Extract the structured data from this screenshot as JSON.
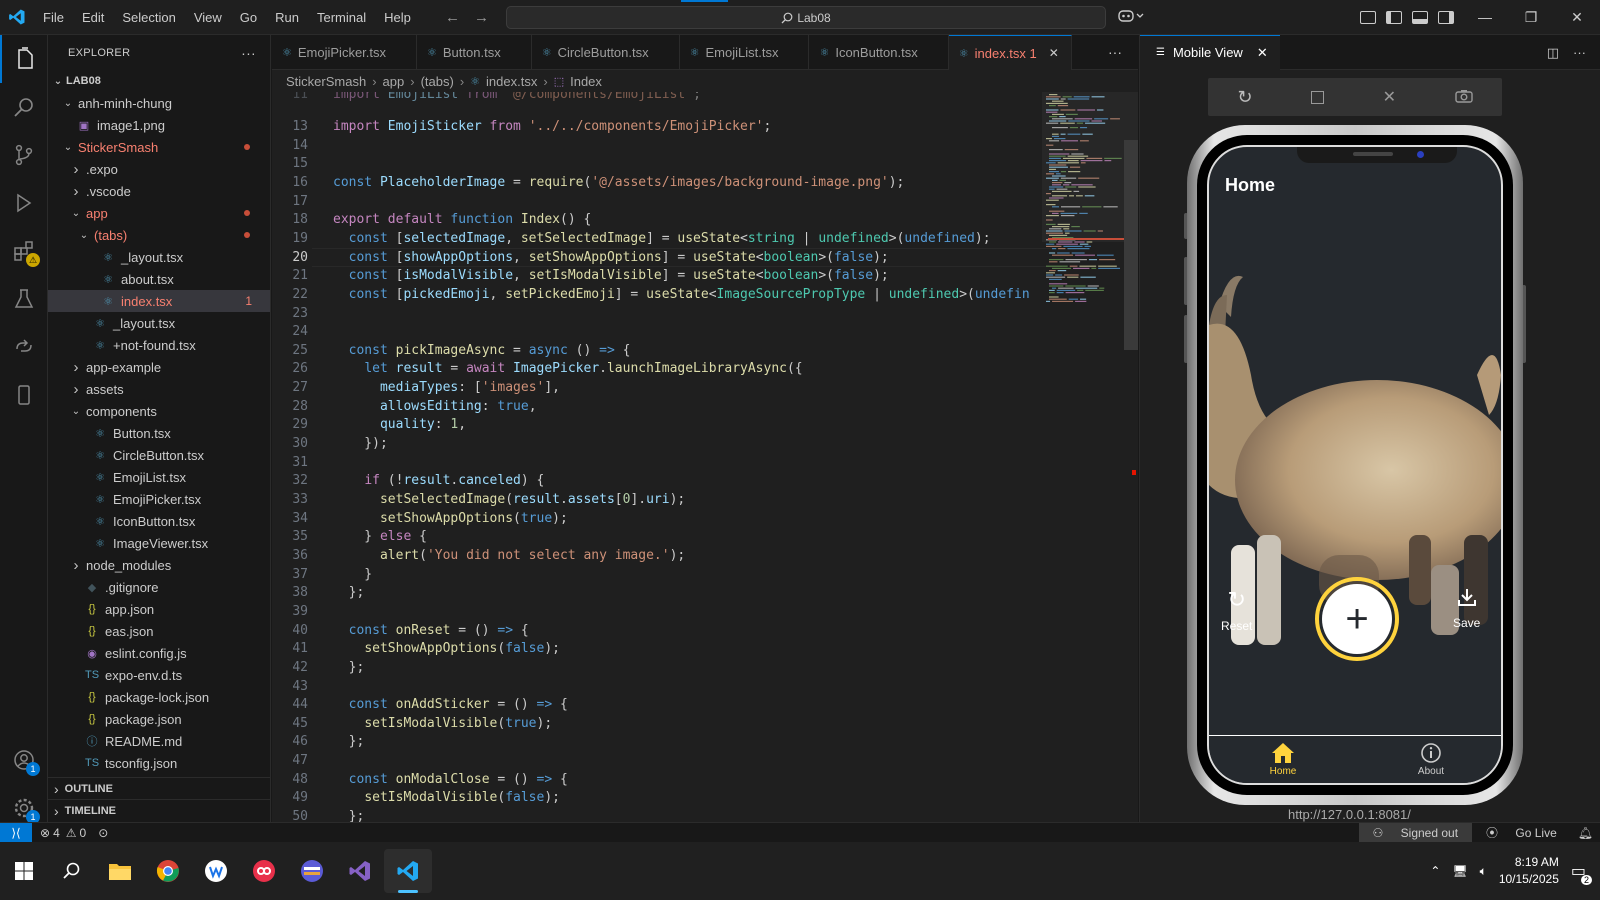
{
  "window": {
    "menu": [
      "File",
      "Edit",
      "Selection",
      "View",
      "Go",
      "Run",
      "Terminal",
      "Help"
    ],
    "search_text": "Lab08"
  },
  "activity_bar": [
    {
      "icon": "files-icon"
    },
    {
      "icon": "search-icon"
    },
    {
      "icon": "source-control-icon"
    },
    {
      "icon": "run-debug-icon"
    },
    {
      "icon": "extensions-icon",
      "badge": "⚠"
    },
    {
      "icon": "testing-icon"
    },
    {
      "icon": "remote-explorer-icon"
    },
    {
      "icon": "device-icon"
    }
  ],
  "activity_bottom": [
    {
      "icon": "account-icon",
      "badge": "1"
    },
    {
      "icon": "settings-gear-icon",
      "badge": "1"
    }
  ],
  "sidebar": {
    "title": "EXPLORER",
    "more": "···",
    "root": "LAB08",
    "items": [
      {
        "label": "anh-minh-chung",
        "depth": 1,
        "type": "folder",
        "open": true
      },
      {
        "label": "image1.png",
        "depth": 1,
        "type": "png"
      },
      {
        "label": "StickerSmash",
        "depth": 1,
        "type": "folder",
        "open": true,
        "modified": true
      },
      {
        "label": ".expo",
        "depth": 2,
        "type": "folder",
        "open": false
      },
      {
        "label": ".vscode",
        "depth": 2,
        "type": "folder",
        "open": false
      },
      {
        "label": "app",
        "depth": 2,
        "type": "folder",
        "open": true,
        "modified": true
      },
      {
        "label": "(tabs)",
        "depth": 3,
        "type": "folder",
        "open": true,
        "modified": true
      },
      {
        "label": "_layout.tsx",
        "depth": 4,
        "type": "tsx"
      },
      {
        "label": "about.tsx",
        "depth": 4,
        "type": "tsx"
      },
      {
        "label": "index.tsx",
        "depth": 4,
        "type": "tsx",
        "selected": true,
        "errors": "1"
      },
      {
        "label": "_layout.tsx",
        "depth": 3,
        "type": "tsx"
      },
      {
        "label": "+not-found.tsx",
        "depth": 3,
        "type": "tsx"
      },
      {
        "label": "app-example",
        "depth": 2,
        "type": "folder",
        "open": false
      },
      {
        "label": "assets",
        "depth": 2,
        "type": "folder",
        "open": false
      },
      {
        "label": "components",
        "depth": 2,
        "type": "folder",
        "open": true
      },
      {
        "label": "Button.tsx",
        "depth": 3,
        "type": "tsx"
      },
      {
        "label": "CircleButton.tsx",
        "depth": 3,
        "type": "tsx"
      },
      {
        "label": "EmojiList.tsx",
        "depth": 3,
        "type": "tsx"
      },
      {
        "label": "EmojiPicker.tsx",
        "depth": 3,
        "type": "tsx"
      },
      {
        "label": "IconButton.tsx",
        "depth": 3,
        "type": "tsx"
      },
      {
        "label": "ImageViewer.tsx",
        "depth": 3,
        "type": "tsx"
      },
      {
        "label": "node_modules",
        "depth": 2,
        "type": "folder",
        "open": false
      },
      {
        "label": ".gitignore",
        "depth": 2,
        "type": "git"
      },
      {
        "label": "app.json",
        "depth": 2,
        "type": "json"
      },
      {
        "label": "eas.json",
        "depth": 2,
        "type": "json"
      },
      {
        "label": "eslint.config.js",
        "depth": 2,
        "type": "eslint"
      },
      {
        "label": "expo-env.d.ts",
        "depth": 2,
        "type": "ts"
      },
      {
        "label": "package-lock.json",
        "depth": 2,
        "type": "json"
      },
      {
        "label": "package.json",
        "depth": 2,
        "type": "json"
      },
      {
        "label": "README.md",
        "depth": 2,
        "type": "md"
      },
      {
        "label": "tsconfig.json",
        "depth": 2,
        "type": "tsjson"
      }
    ],
    "sections": [
      "OUTLINE",
      "TIMELINE"
    ]
  },
  "tabs": [
    {
      "label": "EmojiPicker.tsx"
    },
    {
      "label": "Button.tsx"
    },
    {
      "label": "CircleButton.tsx"
    },
    {
      "label": "EmojiList.tsx"
    },
    {
      "label": "IconButton.tsx"
    },
    {
      "label": "index.tsx 1",
      "active": true
    }
  ],
  "tabs_more": "···",
  "breadcrumb": [
    "StickerSmash",
    "app",
    "(tabs)",
    "index.tsx",
    "Index"
  ],
  "editor": {
    "current_line": 20,
    "lines": [
      {
        "n": 11,
        "html": "<span class='kc'>import</span> <span class='v'>EmojiList</span> <span class='kc'>from</span> <span class='s'>'@/components/EmojiList'</span>;"
      },
      {
        "n": 13,
        "html": "<span class='kc'>import</span> <span class='v'>EmojiSticker</span> <span class='kc'>from</span> <span class='s'>'../../components/EmojiPicker'</span>;"
      },
      {
        "n": 14,
        "html": ""
      },
      {
        "n": 15,
        "html": ""
      },
      {
        "n": 16,
        "html": "<span class='k'>const</span> <span class='v'>PlaceholderImage</span> = <span class='f'>require</span>(<span class='s'>'@/assets/images/background-image.png'</span>);"
      },
      {
        "n": 17,
        "html": ""
      },
      {
        "n": 18,
        "html": "<span class='kc'>export</span> <span class='kc'>default</span> <span class='k'>function</span> <span class='f'>Index</span>() {"
      },
      {
        "n": 19,
        "html": "  <span class='k'>const</span> [<span class='v'>selectedImage</span>, <span class='f'>setSelectedImage</span>] = <span class='f'>useState</span>&lt;<span class='t'>string</span> | <span class='t'>undefined</span>&gt;(<span class='k'>undefined</span>);"
      },
      {
        "n": 20,
        "html": "  <span class='k'>const</span> [<span class='v'>showAppOptions</span>, <span class='f'>setShowAppOptions</span>] = <span class='f'>useState</span>&lt;<span class='t'>boolean</span>&gt;(<span class='k'>false</span>);"
      },
      {
        "n": 21,
        "html": "  <span class='k'>const</span> [<span class='v'>isModalVisible</span>, <span class='f'>setIsModalVisible</span>] = <span class='f'>useState</span>&lt;<span class='t'>boolean</span>&gt;(<span class='k'>false</span>);"
      },
      {
        "n": 22,
        "html": "  <span class='k'>const</span> [<span class='v'>pickedEmoji</span>, <span class='f'>setPickedEmoji</span>] = <span class='f'>useState</span>&lt;<span class='t'>ImageSourcePropType</span> | <span class='t'>undefined</span>&gt;(<span class='k'>undefin</span>"
      },
      {
        "n": 23,
        "html": ""
      },
      {
        "n": 24,
        "html": ""
      },
      {
        "n": 25,
        "html": "  <span class='k'>const</span> <span class='f'>pickImageAsync</span> = <span class='k'>async</span> () <span class='k'>=&gt;</span> {"
      },
      {
        "n": 26,
        "html": "    <span class='k'>let</span> <span class='v'>result</span> = <span class='kc'>await</span> <span class='v'>ImagePicker</span>.<span class='f'>launchImageLibraryAsync</span>({"
      },
      {
        "n": 27,
        "html": "      <span class='v'>mediaTypes</span>: [<span class='s'>'images'</span>],"
      },
      {
        "n": 28,
        "html": "      <span class='v'>allowsEditing</span>: <span class='k'>true</span>,"
      },
      {
        "n": 29,
        "html": "      <span class='v'>quality</span>: <span class='n'>1</span>,"
      },
      {
        "n": 30,
        "html": "    });"
      },
      {
        "n": 31,
        "html": ""
      },
      {
        "n": 32,
        "html": "    <span class='kc'>if</span> (!<span class='v'>result</span>.<span class='v'>canceled</span>) {"
      },
      {
        "n": 33,
        "html": "      <span class='f'>setSelectedImage</span>(<span class='v'>result</span>.<span class='v'>assets</span>[<span class='n'>0</span>].<span class='v'>uri</span>);"
      },
      {
        "n": 34,
        "html": "      <span class='f'>setShowAppOptions</span>(<span class='k'>true</span>);"
      },
      {
        "n": 35,
        "html": "    } <span class='kc'>else</span> {"
      },
      {
        "n": 36,
        "html": "      <span class='f'>alert</span>(<span class='s'>'You did not select any image.'</span>);"
      },
      {
        "n": 37,
        "html": "    }"
      },
      {
        "n": 38,
        "html": "  };"
      },
      {
        "n": 39,
        "html": ""
      },
      {
        "n": 40,
        "html": "  <span class='k'>const</span> <span class='f'>onReset</span> = () <span class='k'>=&gt;</span> {"
      },
      {
        "n": 41,
        "html": "    <span class='f'>setShowAppOptions</span>(<span class='k'>false</span>);"
      },
      {
        "n": 42,
        "html": "  };"
      },
      {
        "n": 43,
        "html": ""
      },
      {
        "n": 44,
        "html": "  <span class='k'>const</span> <span class='f'>onAddSticker</span> = () <span class='k'>=&gt;</span> {"
      },
      {
        "n": 45,
        "html": "    <span class='f'>setIsModalVisible</span>(<span class='k'>true</span>);"
      },
      {
        "n": 46,
        "html": "  };"
      },
      {
        "n": 47,
        "html": ""
      },
      {
        "n": 48,
        "html": "  <span class='k'>const</span> <span class='f'>onModalClose</span> = () <span class='k'>=&gt;</span> {"
      },
      {
        "n": 49,
        "html": "    <span class='f'>setIsModalVisible</span>(<span class='k'>false</span>);"
      },
      {
        "n": 50,
        "html": "  };"
      }
    ]
  },
  "mobile_view": {
    "tab_label": "Mobile View",
    "app_title": "Home",
    "reset_label": "Reset",
    "save_label": "Save",
    "add_label": "+",
    "nav": [
      {
        "label": "Home",
        "active": true
      },
      {
        "label": "About",
        "active": false
      }
    ],
    "url": "http://127.0.0.1:8081/",
    "accent_color": "#ffd33d"
  },
  "statusbar": {
    "errors": "4",
    "warnings": "0",
    "signed_out": "Signed out",
    "go_live": "Go Live"
  },
  "taskbar": {
    "time": "8:19 AM",
    "date": "10/15/2025",
    "notifications": "2",
    "apps": [
      "start-icon",
      "search-icon",
      "file-explorer-icon",
      "chrome-icon",
      "app-icon-1",
      "app-icon-2",
      "app-icon-3",
      "visual-studio-icon",
      "vscode-icon"
    ]
  }
}
